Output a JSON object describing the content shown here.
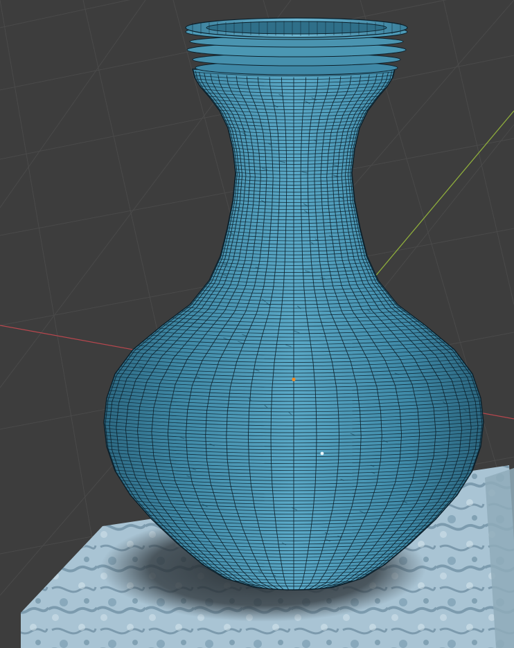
{
  "viewport": {
    "background_color": "#3d3d3d",
    "grid_color": "#4a4a4a",
    "x_axis_color": "#b8474e",
    "y_axis_color": "#8fae3c",
    "view_mode": "solid-shading-with-wireframe"
  },
  "object": {
    "type": "vase",
    "material": "blue-marble",
    "base_color": "#4b97b3",
    "wire_color": "#0b1f2a",
    "origin_marker": "origin-dot",
    "origin_color": "#f08a24"
  },
  "pedestal": {
    "type": "cube",
    "material": "light-marble",
    "color": "#a8c3d3"
  }
}
